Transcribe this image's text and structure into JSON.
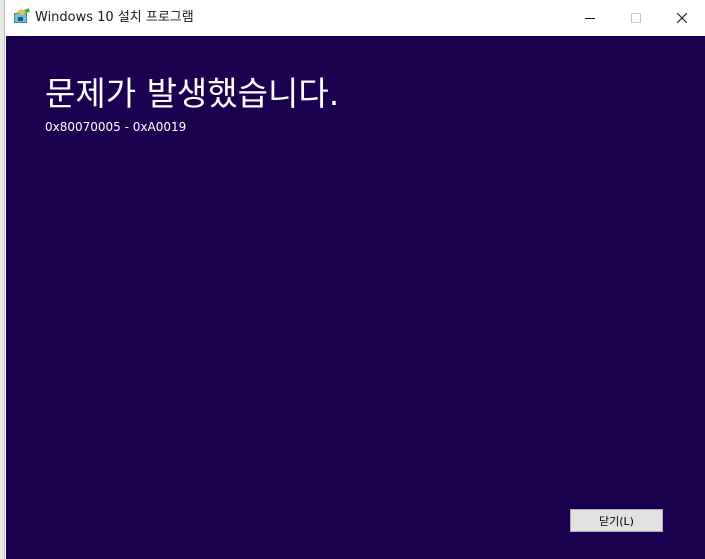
{
  "window": {
    "title": "Windows 10 설치 프로그램",
    "icon": "windows-setup-icon",
    "controls": {
      "minimize_icon": "minimize-icon",
      "maximize_icon": "maximize-icon",
      "close_icon": "close-icon"
    }
  },
  "main": {
    "heading": "문제가 발생했습니다.",
    "error_code": "0x80070005 - 0xA0019",
    "close_button_label": "닫기(L)"
  },
  "colors": {
    "background": "#1b0050",
    "text": "#ffffff",
    "titlebar": "#ffffff",
    "button_face": "#e1e1e1"
  }
}
